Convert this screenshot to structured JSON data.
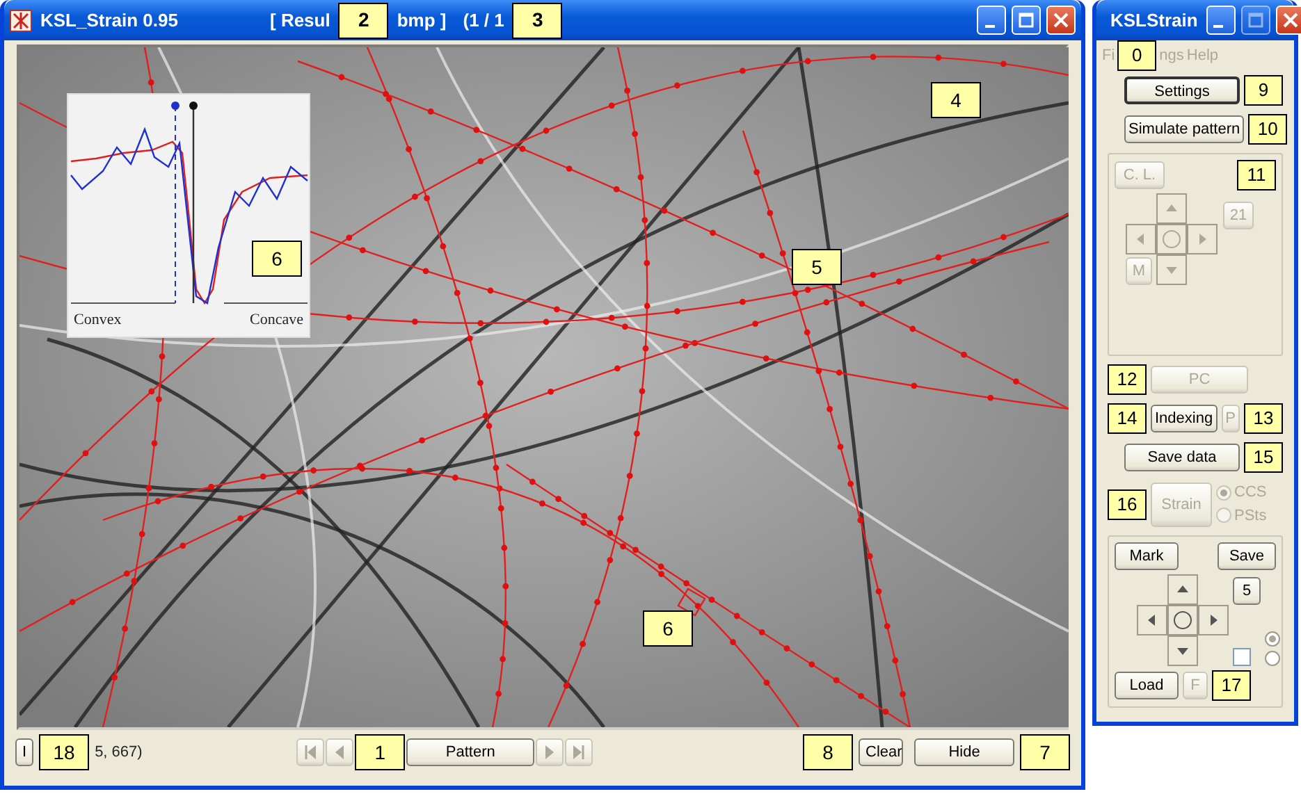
{
  "main_window": {
    "title_parts": [
      {
        "text": "KSL_Strain 0.95"
      },
      {
        "text": "[ Resul",
        "callout": "2"
      },
      {
        "text": "bmp ]"
      },
      {
        "text": "(1 / 1",
        "callout": "3"
      }
    ],
    "image_callouts": [
      {
        "label": "4"
      },
      {
        "label": "5"
      },
      {
        "label": "6"
      }
    ],
    "profile_inset": {
      "left_label": "Convex",
      "right_label": "Concave",
      "callout": "6"
    },
    "bottom_bar": {
      "info_button": {
        "label": "I",
        "callout": "18"
      },
      "coordinates": "5, 667)",
      "nav_buttons": [
        {
          "kind": "first",
          "disabled": true
        },
        {
          "kind": "prev",
          "disabled": true,
          "callout": "1"
        },
        {
          "kind": "pattern",
          "label": "Pattern",
          "disabled": false
        },
        {
          "kind": "next",
          "disabled": true
        },
        {
          "kind": "last",
          "disabled": true
        }
      ],
      "clear_button": {
        "label": "Clear",
        "callout": "8"
      },
      "hide_button": {
        "label": "Hide",
        "callout": "7"
      }
    }
  },
  "tool_window": {
    "title": "KSLStrain",
    "menu": [
      {
        "text": "Fi",
        "callout": "0",
        "disabled": true
      },
      {
        "text": "ngs",
        "disabled": true
      },
      {
        "text": "Help",
        "disabled": true
      }
    ],
    "settings_button": {
      "label": "Settings",
      "callout": "9",
      "disabled": false
    },
    "simulate_button": {
      "label": "Simulate pattern",
      "callout": "10",
      "disabled": false
    },
    "calibration_box": {
      "callout": "11",
      "cl_button": {
        "label": "C. L.",
        "disabled": true
      },
      "count_button": {
        "label": "21",
        "disabled": true
      },
      "m_button": {
        "label": "M",
        "disabled": true
      }
    },
    "pc_button": {
      "label": "PC",
      "callout": "12",
      "disabled": true
    },
    "indexing_button": {
      "label": "Indexing",
      "callout": "14",
      "disabled": false
    },
    "p_button": {
      "label": "P",
      "callout": "13",
      "disabled": true
    },
    "save_data_button": {
      "label": "Save data",
      "callout": "15",
      "disabled": false
    },
    "strain_button": {
      "label": "Strain",
      "callout": "16",
      "disabled": true
    },
    "frame_radios": [
      {
        "label": "CCS",
        "selected": true,
        "disabled": true
      },
      {
        "label": "PSts",
        "selected": false,
        "disabled": true
      }
    ],
    "mark_box": {
      "mark_button": {
        "label": "Mark",
        "disabled": false
      },
      "save_button": {
        "label": "Save",
        "disabled": false
      },
      "step_button": {
        "label": "5",
        "disabled": false
      },
      "checkbox": {
        "checked": false
      },
      "radios": [
        {
          "selected": true
        },
        {
          "selected": false
        }
      ],
      "load_button": {
        "label": "Load",
        "disabled": false
      },
      "f_button": {
        "label": "F",
        "callout": "17",
        "disabled": true
      }
    }
  }
}
